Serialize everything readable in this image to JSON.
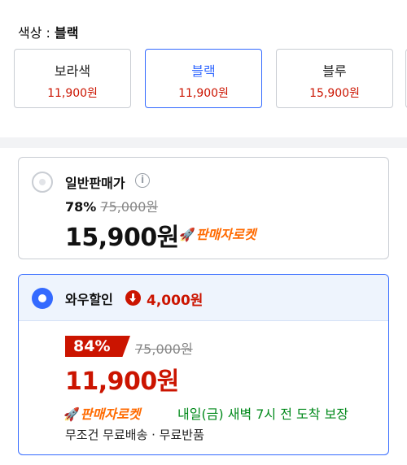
{
  "color_selector": {
    "label": "색상 : ",
    "selected": "블랙",
    "options": [
      {
        "name": "보라색",
        "price": "11,900원"
      },
      {
        "name": "블랙",
        "price": "11,900원"
      },
      {
        "name": "블루",
        "price": "15,900원"
      }
    ]
  },
  "regular_offer": {
    "title": "일반판매가",
    "info_icon": "info-icon",
    "discount_rate": "78%",
    "original_price": "75,000원",
    "price": "15,900원",
    "badge": "판매자로켓"
  },
  "wow_offer": {
    "title": "와우할인",
    "discount_icon": "arrow-down-circle-icon",
    "discount_amount": "4,000원",
    "discount_rate": "84%",
    "original_price": "75,000원",
    "price": "11,900원",
    "badge": "판매자로켓",
    "delivery": "내일(금) 새벽 7시 전 도착 보장",
    "shipping": "무조건 무료배송 · 무료반품"
  },
  "colors": {
    "accent": "#346aff",
    "sale": "#cb1400",
    "rocket": "#ff6a00",
    "delivery": "#00891a"
  }
}
